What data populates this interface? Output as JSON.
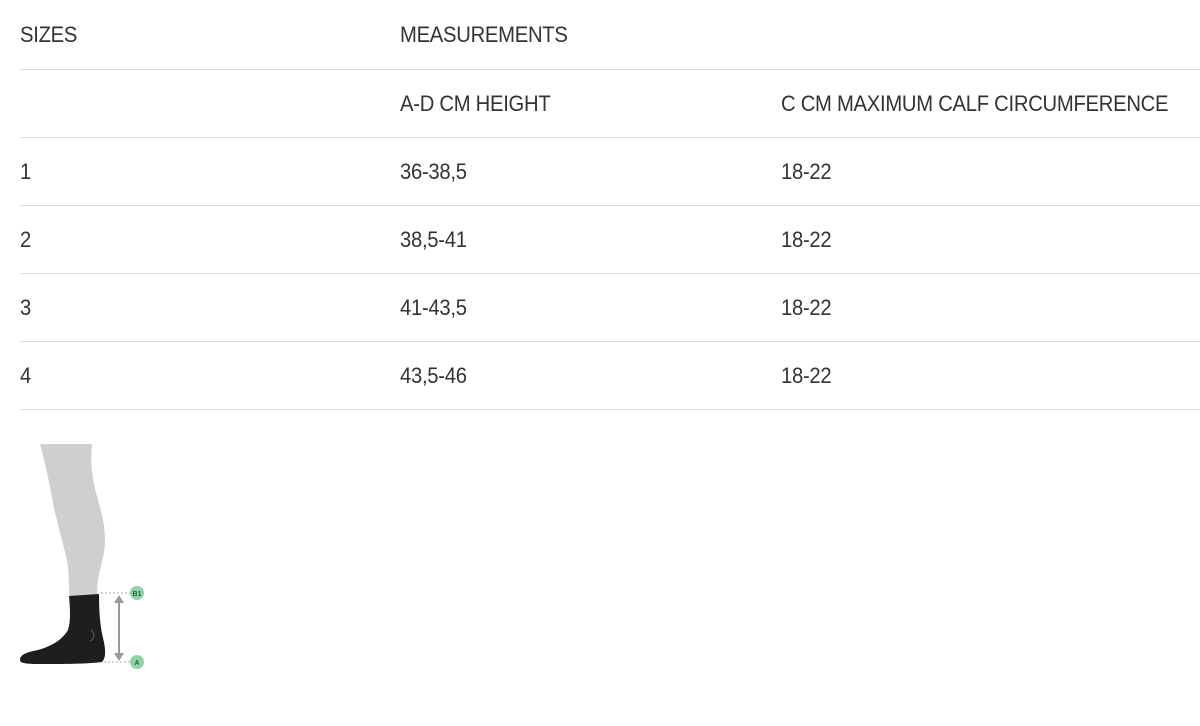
{
  "table": {
    "header": {
      "sizes": "SIZES",
      "measurements": "MEASUREMENTS"
    },
    "subheader": {
      "empty": "",
      "height": "A-D CM HEIGHT",
      "calf": "C CM MAXIMUM CALF CIRCUMFERENCE"
    },
    "rows": [
      {
        "size": "1",
        "height": "36-38,5",
        "calf": "18-22"
      },
      {
        "size": "2",
        "height": "38,5-41",
        "calf": "18-22"
      },
      {
        "size": "3",
        "height": "41-43,5",
        "calf": "18-22"
      },
      {
        "size": "4",
        "height": "43,5-46",
        "calf": "18-22"
      }
    ]
  },
  "illustration": {
    "marker_top": "B1",
    "marker_bottom": "A",
    "leg_color": "#cfcfcf",
    "sock_color": "#1e1e1e",
    "marker_color": "#8fd3a6",
    "arrow_color": "#999999"
  }
}
